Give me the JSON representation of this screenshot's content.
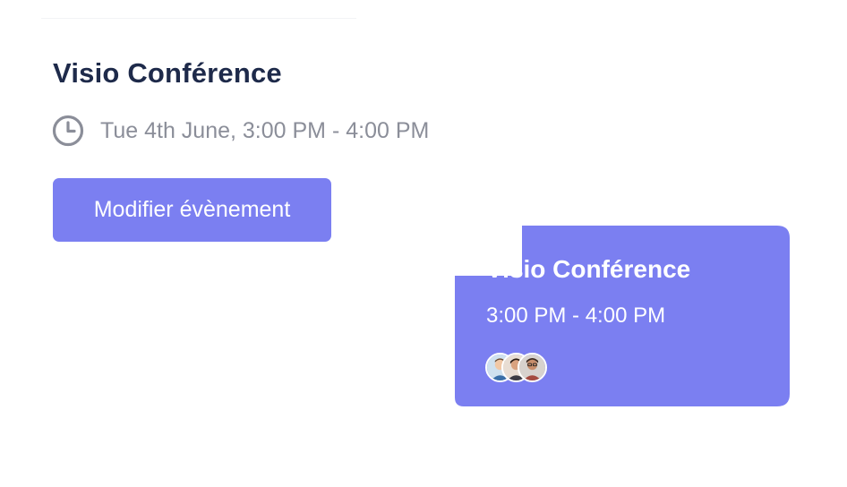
{
  "event_popover": {
    "title": "Visio Conférence",
    "datetime": "Tue 4th June, 3:00 PM - 4:00 PM",
    "edit_button_label": "Modifier évènement",
    "icon": "clock-icon"
  },
  "event_card": {
    "title": "Visio Conférence",
    "time_range": "3:00 PM - 4:00 PM",
    "attendees": [
      {
        "avatar": "avatar-1"
      },
      {
        "avatar": "avatar-2"
      },
      {
        "avatar": "avatar-3"
      }
    ]
  },
  "colors": {
    "accent": "#7b7ff1",
    "title_text": "#1e2a4a",
    "muted_text": "#8b8e99",
    "card_text": "#ffffff"
  }
}
